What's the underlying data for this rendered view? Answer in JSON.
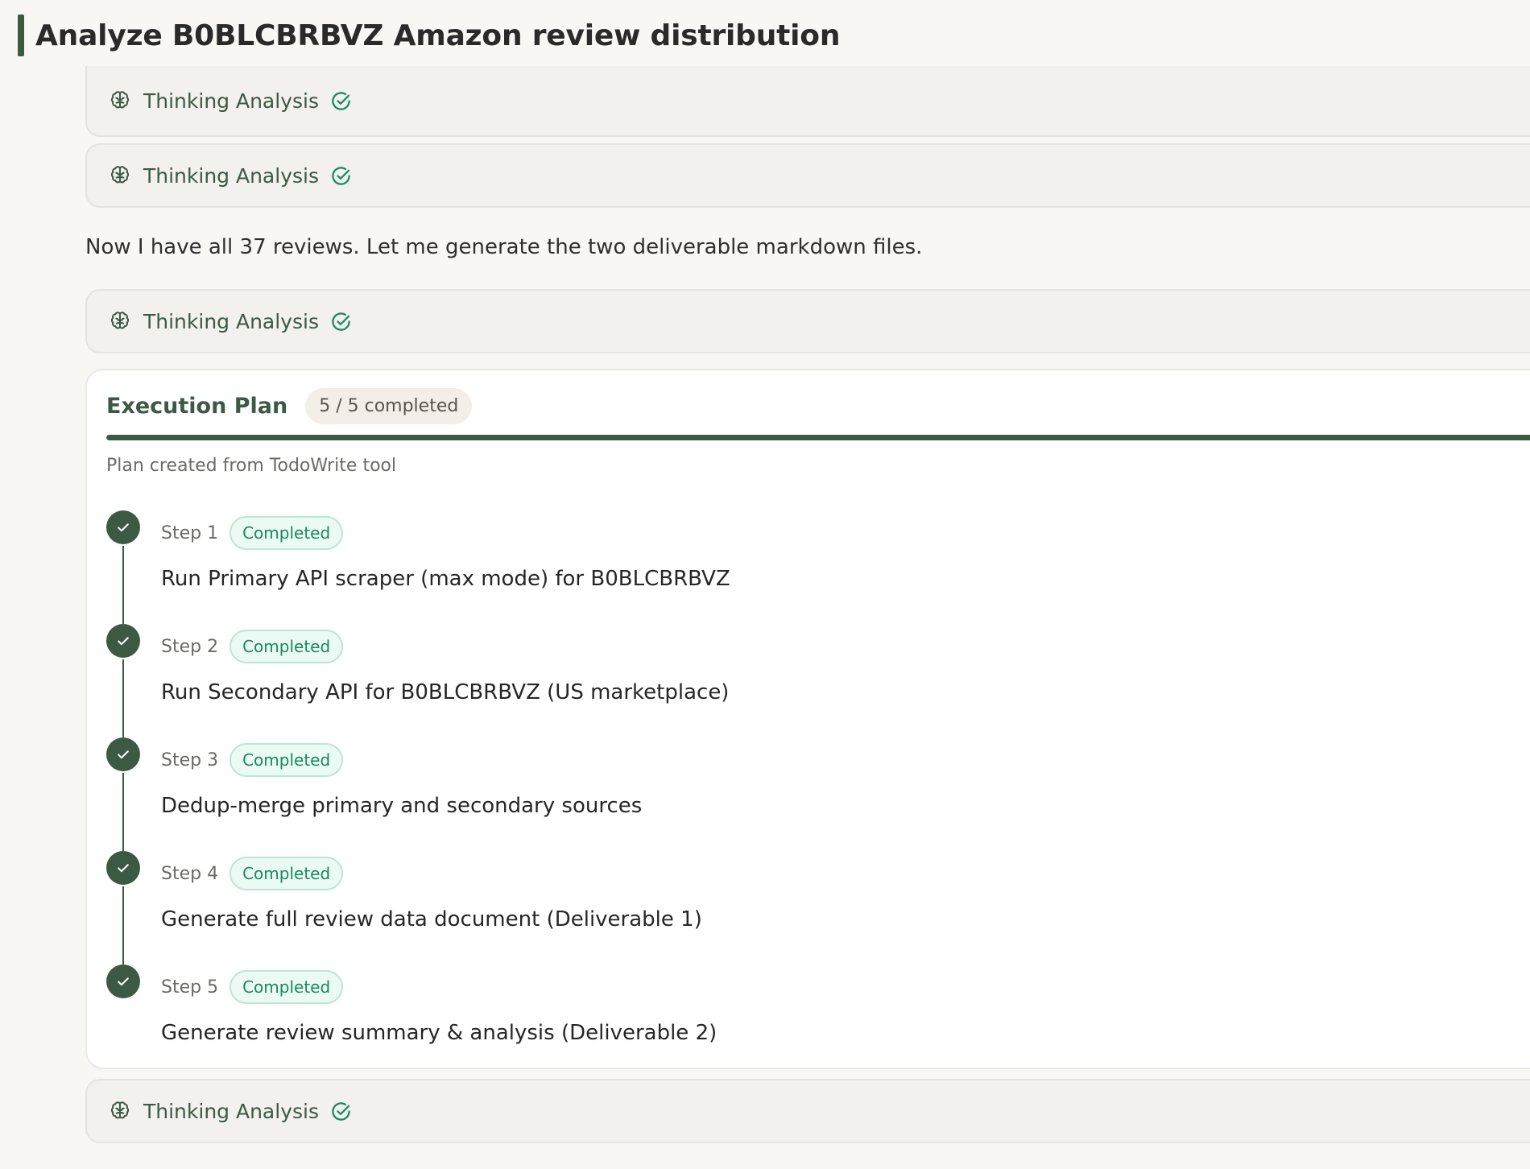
{
  "page": {
    "title": "Analyze B0BLCBRBVZ Amazon review distribution"
  },
  "thinking_label": "Thinking Analysis",
  "message": "Now I have all 37 reviews. Let me generate the two deliverable markdown files.",
  "plan": {
    "title": "Execution Plan",
    "badge": "5 / 5 completed",
    "progress_fraction": 1.0,
    "subtitle": "Plan created from TodoWrite tool",
    "steps": [
      {
        "label": "Step 1",
        "status": "Completed",
        "text": "Run Primary API scraper (max mode) for B0BLCBRBVZ"
      },
      {
        "label": "Step 2",
        "status": "Completed",
        "text": "Run Secondary API for B0BLCBRBVZ (US marketplace)"
      },
      {
        "label": "Step 3",
        "status": "Completed",
        "text": "Dedup-merge primary and secondary sources"
      },
      {
        "label": "Step 4",
        "status": "Completed",
        "text": "Generate full review data document (Deliverable 1)"
      },
      {
        "label": "Step 5",
        "status": "Completed",
        "text": "Generate review summary & analysis (Deliverable 2)"
      }
    ]
  },
  "icons": {
    "thinking": "brain-icon",
    "done": "check-circle-icon",
    "step_done": "check-icon"
  },
  "colors": {
    "accent": "#3c5a43",
    "status_green": "#16895f"
  }
}
